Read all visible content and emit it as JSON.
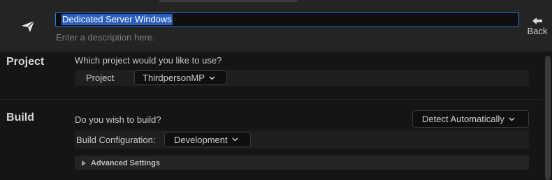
{
  "header": {
    "name_value": "Dedicated Server Windows",
    "description_placeholder": "Enter a description here.",
    "back_label": "Back",
    "icon": "paper-plane-icon"
  },
  "project_section": {
    "title": "Project",
    "question": "Which project would you like to use?",
    "field_label": "Project",
    "selected": "ThirdpersonMP"
  },
  "build_section": {
    "title": "Build",
    "question": "Do you wish to build?",
    "build_mode_selected": "Detect Automatically",
    "config_label": "Build Configuration:",
    "config_selected": "Development",
    "advanced_label": "Advanced Settings"
  },
  "colors": {
    "accent": "#2e7ee8",
    "selection": "#2a5fbd",
    "background": "#151515",
    "header": "#242424"
  }
}
